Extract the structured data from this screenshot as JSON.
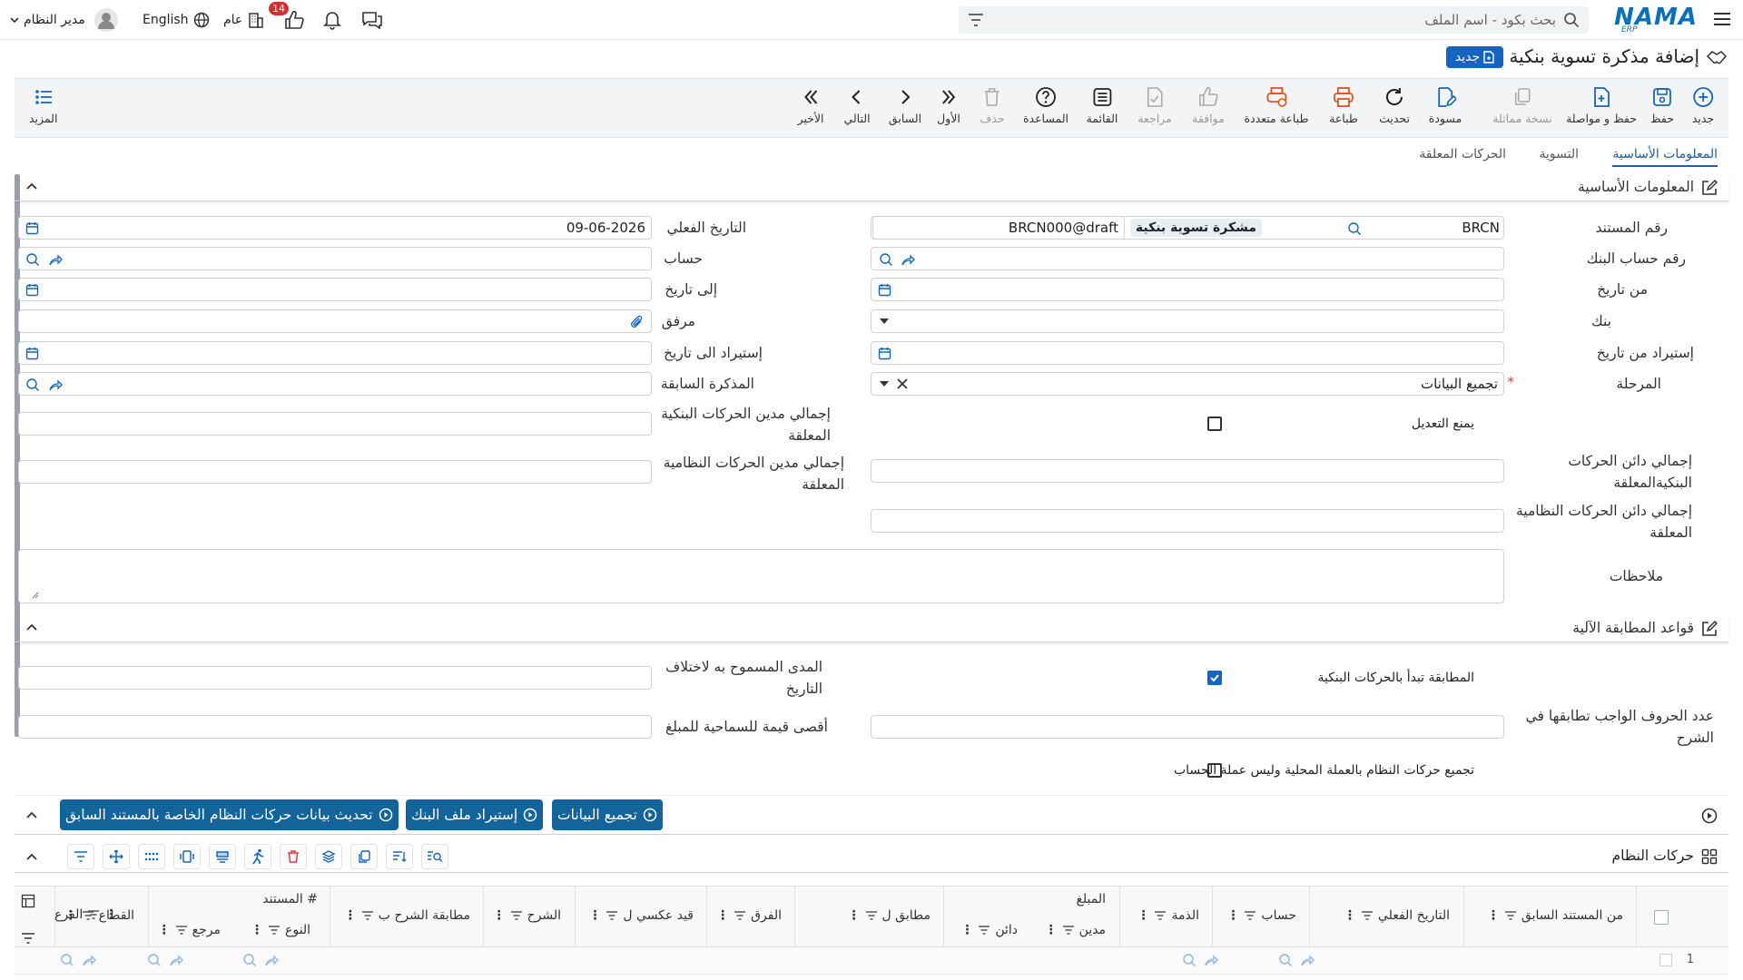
{
  "topbar": {
    "logo_text": "NAMA",
    "logo_sub": "ERP",
    "search_placeholder": "بحث بكود - اسم الملف",
    "user_name": "مدير النظام",
    "language": "English",
    "general": "عام",
    "notification_count": "14"
  },
  "page": {
    "title": "إضافة مذكرة تسوية بنكية",
    "status_badge": "جديد"
  },
  "toolbar": {
    "new": "جديد",
    "save": "حفظ",
    "save_continue": "حفظ و مواصلة",
    "duplicate": "نسخة مماثلة",
    "draft": "مسودة",
    "refresh": "تحديث",
    "print": "طباعة",
    "multi_print": "طباعة متعددة",
    "approve": "موافقة",
    "review": "مراجعة",
    "list": "القائمة",
    "help": "المساعدة",
    "delete": "حذف",
    "first": "الأول",
    "previous": "السابق",
    "next": "التالي",
    "last": "الأخير",
    "more": "المزيد"
  },
  "tabs": {
    "basic": "المعلومات الأساسية",
    "settlement": "التسوية",
    "pending": "الحركات المعلقة"
  },
  "basic_section": {
    "title": "المعلومات الأساسية",
    "doc_number_label": "رقم المستند",
    "doc_number_value": "BRCN",
    "doc_type_tag": "مشكرة تسوية بنكية",
    "doc_code": "BRCN000@draft",
    "actual_date_label": "التاريخ الفعلي",
    "actual_date_value": "09-06-2026",
    "bank_account_label": "رقم حساب البنك",
    "account_label": "حساب",
    "from_date_label": "من تاريخ",
    "to_date_label": "إلى تاريخ",
    "bank_label": "بنك",
    "attachment_label": "مرفق",
    "import_from_label": "إستيراد من تاريخ",
    "import_to_label": "إستيراد الى تاريخ",
    "stage_label": "المرحلة",
    "stage_value": "تجميع البيانات",
    "prev_memo_label": "المذكرة السابقة",
    "prevent_edit_label": "يمنع التعديل",
    "total_bank_debit_pending_label": "إجمالي مدين الحركات البنكية المعلقة",
    "total_bank_credit_pending_label": "إجمالي دائن الحركات البنكيةالمعلقة",
    "total_sys_debit_pending_label": "إجمالي مدين الحركات النظامية المعلقة",
    "total_sys_credit_pending_label": "إجمالي دائن الحركات النظامية المعلقة",
    "notes_label": "ملاحظات"
  },
  "matching_section": {
    "title": "قواعد المطابقة الآلية",
    "start_with_bank_label": "المطابقة تبدأ بالحركات البنكية",
    "allowed_date_range_label": "المدى المسموح به لاختلاف التاريخ",
    "chars_to_match_label": "عدد الحروف الواجب تطابقها في الشرح",
    "max_amount_tolerance_label": "أقصى قيمة للسماحية للمبلغ",
    "group_local_currency_label": "تجميع حركات النظام بالعملة المحلية وليس عملة الحساب"
  },
  "actions": {
    "collect_data": "تجميع البيانات",
    "import_bank_file": "إستيراد ملف البنك",
    "update_prev": "تحديث بيانات حركات النظام الخاصة بالمستند السابق"
  },
  "grid": {
    "title": "حركات النظام",
    "columns": {
      "from_prev_doc": "من المستند السابق",
      "actual_date": "التاريخ الفعلي",
      "account": "حساب",
      "liability": "الذمة",
      "amount": "المبلغ",
      "debit": "مدين",
      "credit": "دائن",
      "matched": "مطابق ل",
      "difference": "الفرق",
      "reverse_entry": "قيد عكسي ل",
      "description": "الشرح",
      "desc_match": "مطابقة الشرح ب",
      "document": "# المستند",
      "type": "النوع",
      "reference": "مرجع",
      "sector": "القطاع",
      "branch": "الفرع"
    },
    "row_number": "1"
  }
}
